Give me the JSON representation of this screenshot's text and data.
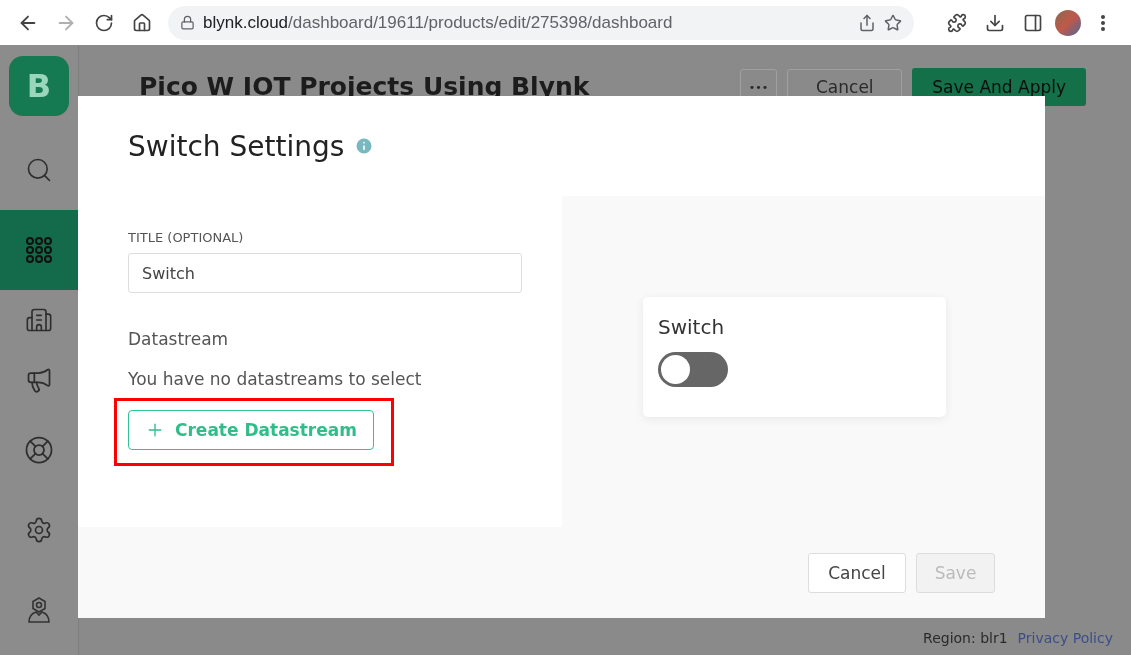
{
  "browser": {
    "forward_disabled": true,
    "address_host": "blynk.cloud",
    "address_path": "/dashboard/19611/products/edit/275398/dashboard"
  },
  "sidebar": {
    "logo": "B",
    "items": [
      {
        "kind": "search",
        "selected": false
      },
      {
        "kind": "grid",
        "selected": true
      },
      {
        "kind": "building",
        "selected": false
      },
      {
        "kind": "megaphone",
        "selected": false
      },
      {
        "kind": "lifebuoy",
        "selected": false
      },
      {
        "kind": "gear",
        "selected": false
      },
      {
        "kind": "user",
        "selected": false
      }
    ]
  },
  "page": {
    "title": "Pico W IOT Projects Using Blynk",
    "more_button": "•••",
    "cancel_button": "Cancel",
    "save_apply_button": "Save And Apply"
  },
  "footer": {
    "region": "Region: blr1",
    "privacy_link": "Privacy Policy"
  },
  "dialog": {
    "title": "Switch Settings",
    "title_field": {
      "label": "TITLE (OPTIONAL)",
      "value": "Switch"
    },
    "datastream": {
      "heading": "Datastream",
      "message": "You have no datastreams to select",
      "create_button": "Create Datastream"
    },
    "preview": {
      "label": "Switch",
      "on": false
    },
    "cancel_button": "Cancel",
    "save_button": {
      "label": "Save",
      "disabled": true
    }
  }
}
